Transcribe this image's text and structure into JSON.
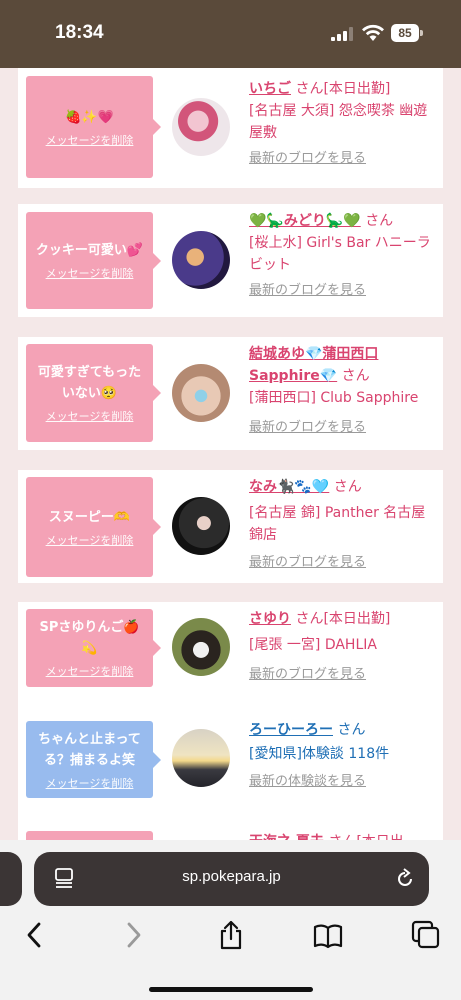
{
  "status": {
    "time": "18:34",
    "battery": "85"
  },
  "cards": [
    {
      "message": "🍓✨💗",
      "delete_label": "メッセージを削除",
      "name": "いちご",
      "san": "さん",
      "tag": "[本日出勤]",
      "shop": "[名古屋 大須] 怨念喫茶 幽遊屋敷",
      "link": "最新のブログを見る"
    },
    {
      "message": "クッキー可愛い💕",
      "delete_label": "メッセージを削除",
      "name": "💚🦕みどり🦕💚",
      "san": "さん",
      "shop": "[桜上水] Girl's Bar ハニーラビット",
      "link": "最新のブログを見る"
    },
    {
      "message": "可愛すぎてもったいない🥺",
      "delete_label": "メッセージを削除",
      "name": "結城あゆ💎蒲田西口Sapphire💎",
      "san": "さん",
      "shop": "[蒲田西口] Club Sapphire",
      "link": "最新のブログを見る"
    },
    {
      "message": "スヌーピー🫶",
      "delete_label": "メッセージを削除",
      "name": "なみ🐈‍⬛🐾🩵",
      "san": "さん",
      "shop": "[名古屋 錦] Panther 名古屋錦店",
      "link": "最新のブログを見る"
    },
    {
      "message": "SPさゆりんご🍎💫",
      "delete_label": "メッセージを削除",
      "name": "さゆり",
      "san": "さん",
      "tag": "[本日出勤]",
      "shop": "[尾張 一宮] DAHLIA",
      "link": "最新のブログを見る"
    },
    {
      "message": "ちゃんと止まってる？捕まるよ笑",
      "delete_label": "メッセージを削除",
      "name": "ろーひーろー",
      "san": "さん",
      "shop": "[愛知県]体験談 118件",
      "link": "最新の体験談を見る"
    },
    {
      "message": "",
      "name": "天海之 夏夫",
      "san": "さん",
      "tag": "[本日出"
    }
  ],
  "browser": {
    "url": "sp.pokepara.jp"
  },
  "colors": {
    "status_bar": "#5a4a3a",
    "pink_bubble": "#f4a2b6",
    "blue_bubble": "#98bbee",
    "name_pink": "#d9446f",
    "name_blue": "#1f6fb5"
  }
}
